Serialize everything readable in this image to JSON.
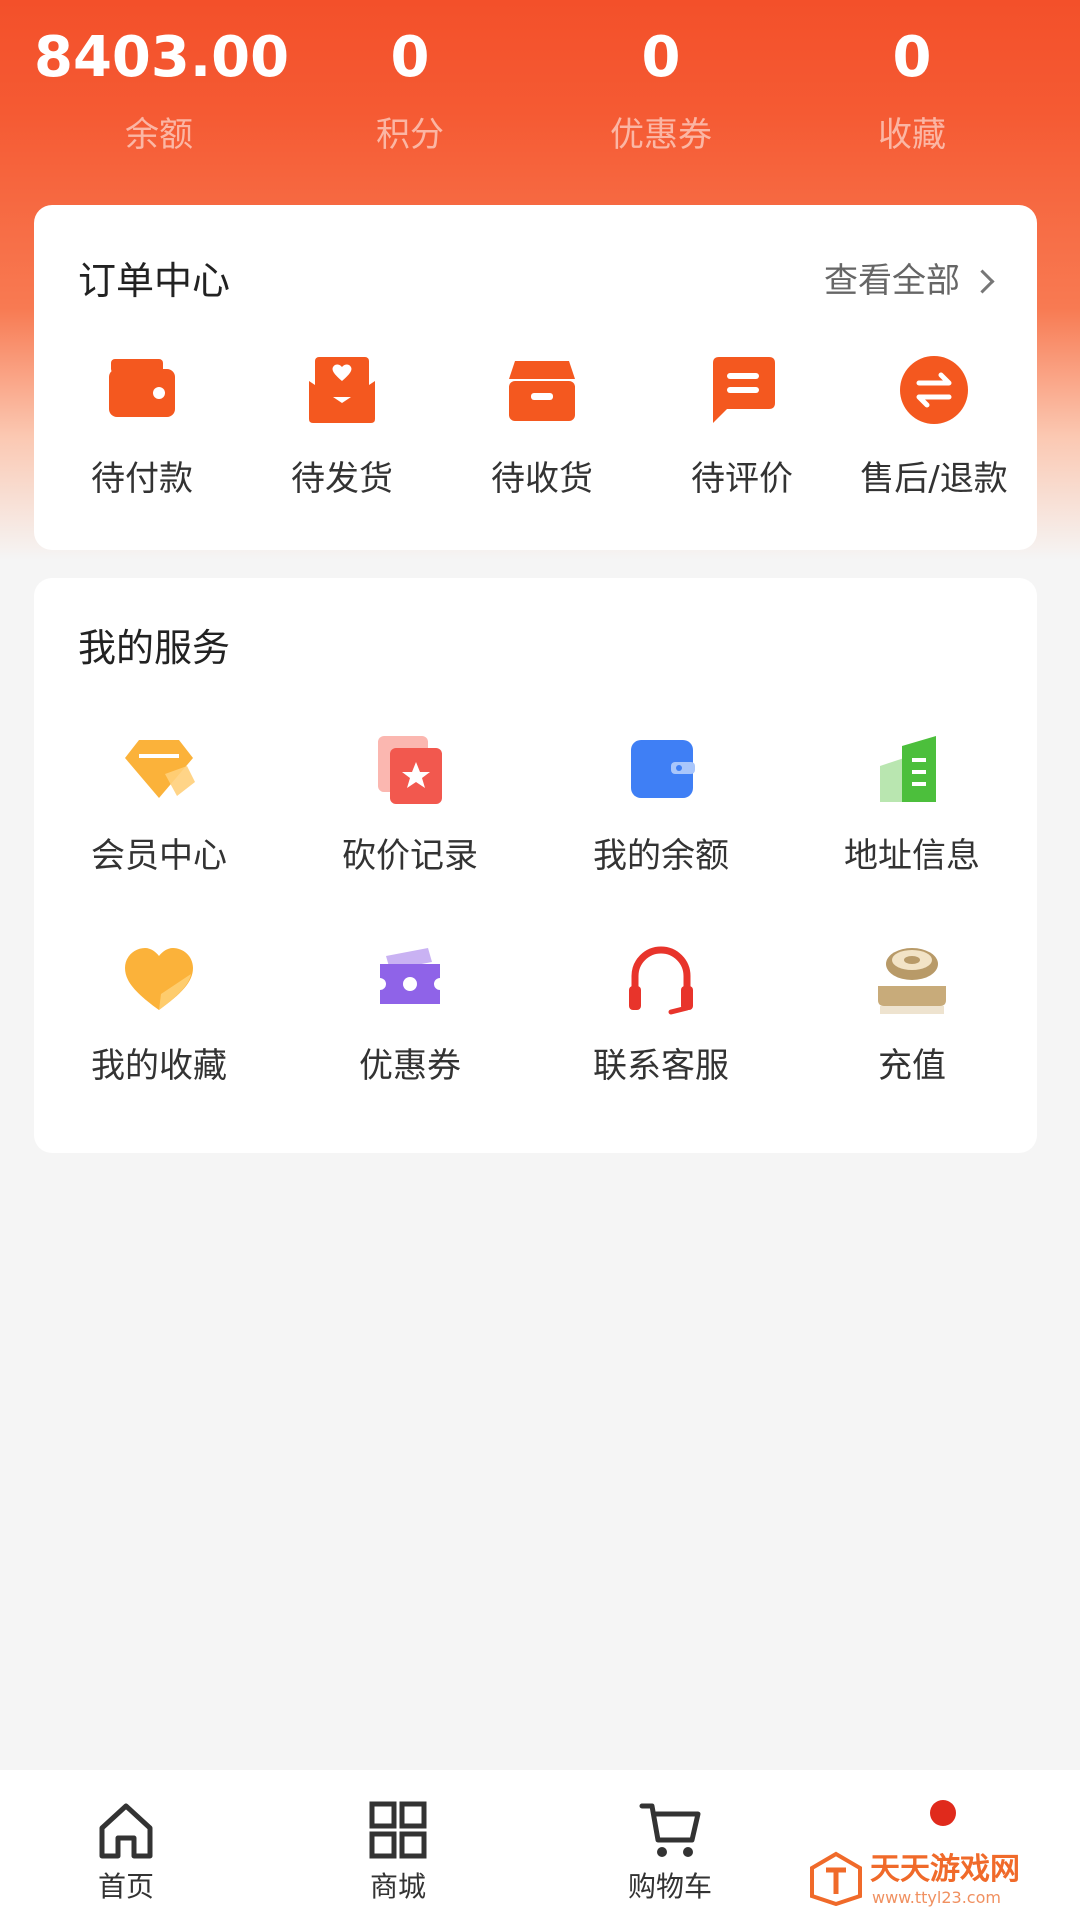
{
  "stats": [
    {
      "value": "8403.00",
      "label": "余额"
    },
    {
      "value": "0",
      "label": "积分"
    },
    {
      "value": "0",
      "label": "优惠券"
    },
    {
      "value": "0",
      "label": "收藏"
    }
  ],
  "orders": {
    "title": "订单中心",
    "view_all": "查看全部",
    "items": [
      {
        "label": "待付款",
        "icon": "wallet-icon"
      },
      {
        "label": "待发货",
        "icon": "package-heart-icon"
      },
      {
        "label": "待收货",
        "icon": "box-icon"
      },
      {
        "label": "待评价",
        "icon": "comment-icon"
      },
      {
        "label": "售后/退款",
        "icon": "exchange-icon"
      }
    ]
  },
  "services": {
    "title": "我的服务",
    "items": [
      {
        "label": "会员中心",
        "icon": "diamond-icon"
      },
      {
        "label": "砍价记录",
        "icon": "star-card-icon"
      },
      {
        "label": "我的余额",
        "icon": "card-wallet-icon"
      },
      {
        "label": "地址信息",
        "icon": "building-icon"
      },
      {
        "label": "我的收藏",
        "icon": "heart-icon"
      },
      {
        "label": "优惠券",
        "icon": "ticket-icon"
      },
      {
        "label": "联系客服",
        "icon": "headset-icon"
      },
      {
        "label": "充值",
        "icon": "coin-stack-icon"
      }
    ]
  },
  "tabbar": [
    {
      "label": "首页",
      "icon": "home-icon"
    },
    {
      "label": "商城",
      "icon": "grid-icon"
    },
    {
      "label": "购物车",
      "icon": "cart-icon"
    }
  ],
  "watermark": {
    "text": "天天游戏网",
    "url": "www.ttyl23.com"
  },
  "colors": {
    "brand": "#f3502a",
    "order_icon": "#f4581f",
    "badge": "#e02a1c"
  }
}
